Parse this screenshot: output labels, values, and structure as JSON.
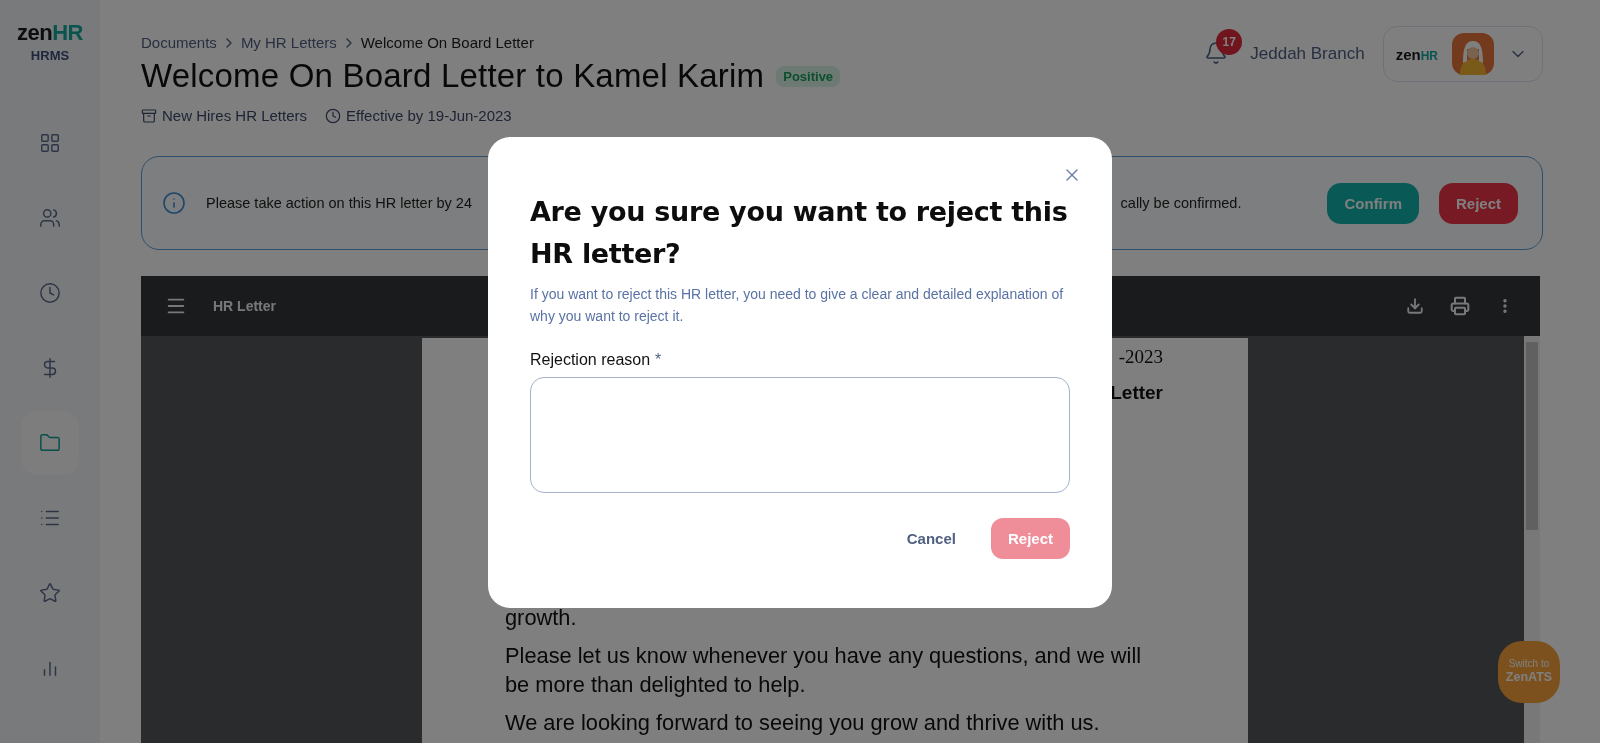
{
  "sidebar": {
    "logo": {
      "brand": "zen",
      "accent": "HR"
    },
    "product": "HRMS",
    "items": [
      {
        "kind": "grid",
        "selected": false
      },
      {
        "kind": "people",
        "selected": false
      },
      {
        "kind": "clock",
        "selected": false
      },
      {
        "kind": "money",
        "selected": false
      },
      {
        "kind": "folder",
        "selected": true
      },
      {
        "kind": "list",
        "selected": false
      },
      {
        "kind": "star",
        "selected": false
      },
      {
        "kind": "chart",
        "selected": false
      }
    ]
  },
  "breadcrumb": [
    {
      "label": "Documents",
      "current": false
    },
    {
      "label": "My HR Letters",
      "current": false
    },
    {
      "label": "Welcome On Board Letter",
      "current": true
    }
  ],
  "title": "Welcome On Board Letter to Kamel Karim",
  "badge": "Positive",
  "meta": [
    {
      "kind": "archive",
      "text": "New Hires HR Letters"
    },
    {
      "kind": "clock",
      "text": "Effective by 19-Jun-2023"
    }
  ],
  "header": {
    "notifications": "17",
    "branch": "Jeddah Branch",
    "company_logo": {
      "brand": "zen",
      "accent": "HR"
    }
  },
  "alert": {
    "text_start": "Please take action on this HR letter by 24",
    "text_end": "cally be confirmed.",
    "buttons": [
      {
        "label": "Confirm",
        "kind": "confirm"
      },
      {
        "label": "Reject",
        "kind": "reject"
      }
    ]
  },
  "viewer": {
    "title": "HR Letter",
    "page": {
      "fragments": [
        {
          "kind": "date",
          "text": "-2023"
        },
        {
          "kind": "heading",
          "text": "Letter"
        }
      ],
      "paragraphs": [
        "growth.",
        "Please let us know whenever you have any questions, and we will be more than delighted to help.",
        "We are looking forward to seeing you grow and thrive with us."
      ]
    }
  },
  "switch_button": {
    "line_1": "Switch to",
    "line_2": "ZenATS"
  },
  "dialog": {
    "title": "Are you sure you want to reject this HR letter?",
    "description": "If you want to reject this HR letter, you need to give a clear and detailed explanation of why you want to reject it.",
    "field_label": "Rejection reason",
    "required_mark": "*",
    "buttons": [
      {
        "label": "Cancel",
        "kind": "text"
      },
      {
        "label": "Reject",
        "kind": "danger",
        "disabled": true
      }
    ]
  }
}
